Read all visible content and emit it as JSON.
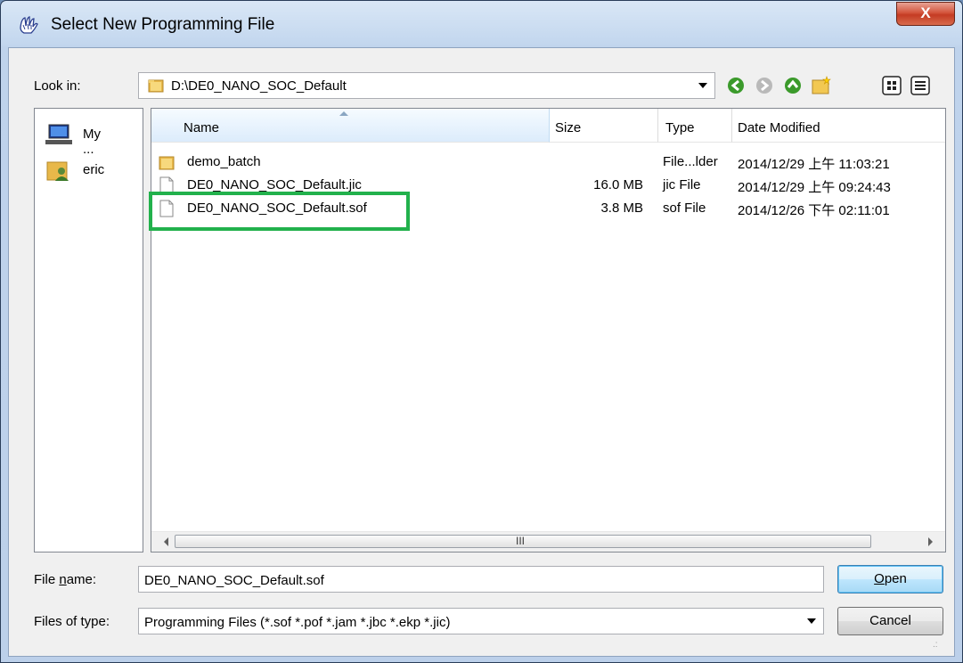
{
  "window": {
    "title": "Select New Programming File",
    "close_label": "X"
  },
  "lookin": {
    "label": "Look in:",
    "path": "D:\\DE0_NANO_SOC_Default"
  },
  "toolbar": {
    "icons": [
      "back-icon",
      "forward-icon",
      "up-folder-icon",
      "new-folder-icon",
      "list-view-icon",
      "detail-view-icon"
    ]
  },
  "places": [
    {
      "label": "My ...",
      "icon": "computer-icon"
    },
    {
      "label": "eric",
      "icon": "user-folder-icon"
    }
  ],
  "columns": {
    "name": "Name",
    "size": "Size",
    "type": "Type",
    "date": "Date Modified"
  },
  "files": [
    {
      "name": "demo_batch",
      "size": "",
      "type": "File...lder",
      "date": "2014/12/29 上午 11:03:21",
      "icon": "folder-icon"
    },
    {
      "name": "DE0_NANO_SOC_Default.jic",
      "size": "16.0 MB",
      "type": "jic File",
      "date": "2014/12/29 上午 09:24:43",
      "icon": "file-icon"
    },
    {
      "name": "DE0_NANO_SOC_Default.sof",
      "size": "3.8 MB",
      "type": "sof File",
      "date": "2014/12/26 下午 02:11:01",
      "icon": "file-icon"
    }
  ],
  "scroll": {
    "grip": "III"
  },
  "filename": {
    "label_pre": "File ",
    "label_u": "n",
    "label_post": "ame:",
    "value": "DE0_NANO_SOC_Default.sof"
  },
  "filetype": {
    "label": "Files of type:",
    "value": "Programming Files (*.sof *.pof *.jam *.jbc *.ekp *.jic)"
  },
  "buttons": {
    "open_u": "O",
    "open_rest": "pen",
    "cancel": "Cancel"
  },
  "colors": {
    "highlight": "#22b14c",
    "titlebar": "#c2d6ee"
  }
}
